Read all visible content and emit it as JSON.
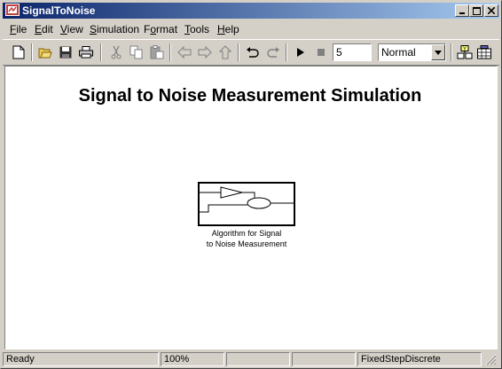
{
  "window": {
    "title": "SignalToNoise"
  },
  "menu": {
    "file": {
      "pre": "",
      "u": "F",
      "post": "ile"
    },
    "edit": {
      "pre": "",
      "u": "E",
      "post": "dit"
    },
    "view": {
      "pre": "",
      "u": "V",
      "post": "iew"
    },
    "simulation": {
      "pre": "",
      "u": "S",
      "post": "imulation"
    },
    "format": {
      "pre": "F",
      "u": "o",
      "post": "rmat"
    },
    "tools": {
      "pre": "",
      "u": "T",
      "post": "ools"
    },
    "help": {
      "pre": "",
      "u": "H",
      "post": "elp"
    }
  },
  "toolbar": {
    "stop_time": "5",
    "sim_mode": "Normal"
  },
  "model": {
    "title": "Signal to Noise Measurement Simulation",
    "block_label_line1": "Algorithm for Signal",
    "block_label_line2": "to Noise Measurement"
  },
  "status": {
    "state": "Ready",
    "zoom": "100%",
    "solver": "FixedStepDiscrete"
  }
}
